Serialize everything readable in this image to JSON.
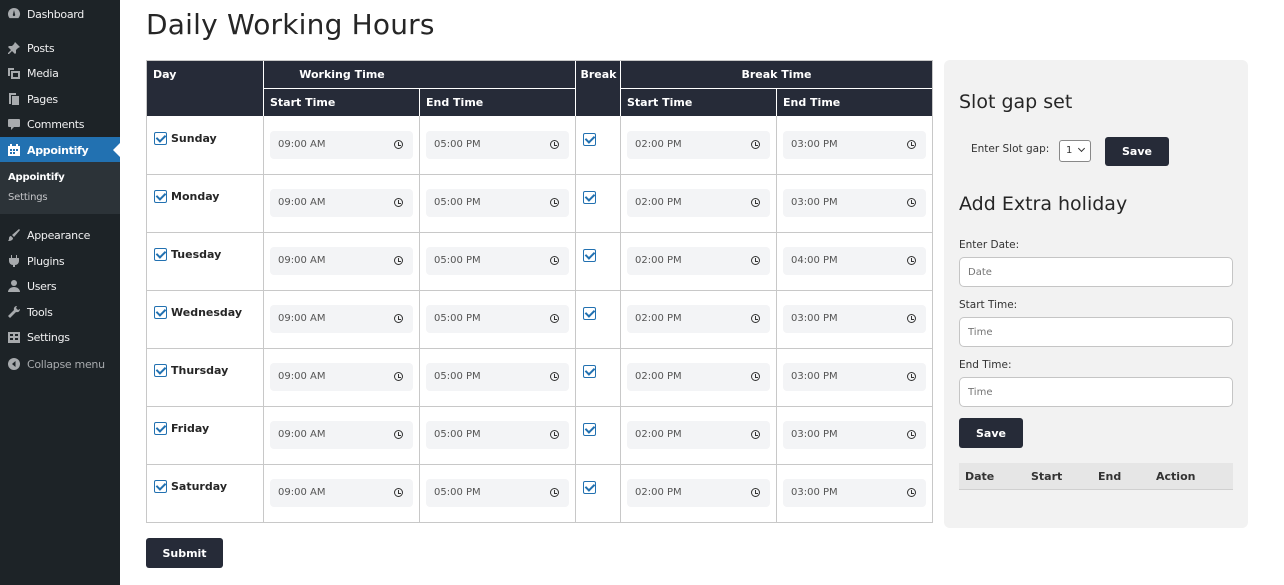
{
  "sidebar": {
    "items": [
      {
        "label": "Dashboard",
        "icon": "dashboard-icon"
      },
      {
        "label": "Posts",
        "icon": "pin-icon"
      },
      {
        "label": "Media",
        "icon": "media-icon"
      },
      {
        "label": "Pages",
        "icon": "pages-icon"
      },
      {
        "label": "Comments",
        "icon": "comment-icon"
      },
      {
        "label": "Appointify",
        "icon": "calendar-icon"
      },
      {
        "label": "Appearance",
        "icon": "brush-icon"
      },
      {
        "label": "Plugins",
        "icon": "plug-icon"
      },
      {
        "label": "Users",
        "icon": "user-icon"
      },
      {
        "label": "Tools",
        "icon": "wrench-icon"
      },
      {
        "label": "Settings",
        "icon": "settings-icon"
      },
      {
        "label": "Collapse menu",
        "icon": "collapse-icon"
      }
    ],
    "submenu": [
      "Appointify",
      "Settings"
    ],
    "accent": "#2271b1"
  },
  "page": {
    "title": "Daily Working Hours",
    "submit_label": "Submit"
  },
  "table": {
    "headers": {
      "day": "Day",
      "working_time": "Working Time",
      "break": "Break",
      "break_time": "Break Time",
      "start_time": "Start Time",
      "end_time": "End Time"
    },
    "rows": [
      {
        "day": "Sunday",
        "start": "09:00 AM",
        "end": "05:00 PM",
        "break_start": "02:00 PM",
        "break_end": "03:00 PM"
      },
      {
        "day": "Monday",
        "start": "09:00 AM",
        "end": "05:00 PM",
        "break_start": "02:00 PM",
        "break_end": "03:00 PM"
      },
      {
        "day": "Tuesday",
        "start": "09:00 AM",
        "end": "05:00 PM",
        "break_start": "02:00 PM",
        "break_end": "04:00 PM"
      },
      {
        "day": "Wednesday",
        "start": "09:00 AM",
        "end": "05:00 PM",
        "break_start": "02:00 PM",
        "break_end": "03:00 PM"
      },
      {
        "day": "Thursday",
        "start": "09:00 AM",
        "end": "05:00 PM",
        "break_start": "02:00 PM",
        "break_end": "03:00 PM"
      },
      {
        "day": "Friday",
        "start": "09:00 AM",
        "end": "05:00 PM",
        "break_start": "02:00 PM",
        "break_end": "03:00 PM"
      },
      {
        "day": "Saturday",
        "start": "09:00 AM",
        "end": "05:00 PM",
        "break_start": "02:00 PM",
        "break_end": "03:00 PM"
      }
    ]
  },
  "slot_gap": {
    "title": "Slot gap set",
    "label": "Enter Slot gap:",
    "value": "1",
    "save_label": "Save"
  },
  "holiday": {
    "title": "Add Extra holiday",
    "date_label": "Enter Date:",
    "date_placeholder": "Date",
    "start_label": "Start Time:",
    "start_placeholder": "Time",
    "end_label": "End Time:",
    "end_placeholder": "Time",
    "save_label": "Save",
    "columns": [
      "Date",
      "Start",
      "End",
      "Action"
    ]
  }
}
